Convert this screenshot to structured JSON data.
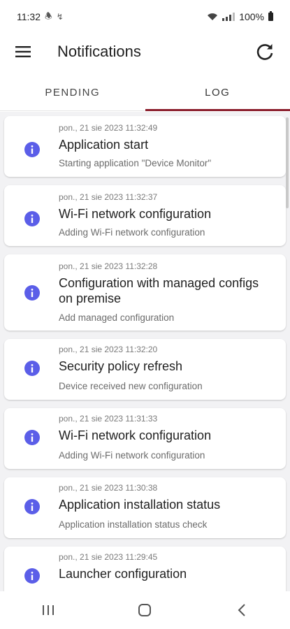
{
  "status_bar": {
    "time": "11:32",
    "battery": "100%",
    "icons": [
      "notification-icon",
      "app-icon",
      "wifi-icon",
      "signal-icon",
      "battery-icon"
    ]
  },
  "appbar": {
    "title": "Notifications",
    "menu_icon": "hamburger-menu-icon",
    "refresh_icon": "refresh-icon"
  },
  "tabs": [
    {
      "label": "PENDING",
      "selected": false
    },
    {
      "label": "LOG",
      "selected": true
    }
  ],
  "accent_color": "#8b1d2c",
  "info_icon_color": "#5b5ee8",
  "log_entries": [
    {
      "time": "pon., 21 sie 2023 11:32:49",
      "title": "Application start",
      "description": "Starting application \"Device Monitor\""
    },
    {
      "time": "pon., 21 sie 2023 11:32:37",
      "title": "Wi-Fi network configuration",
      "description": "Adding Wi-Fi network configuration"
    },
    {
      "time": "pon., 21 sie 2023 11:32:28",
      "title": "Configuration with managed configs on premise",
      "description": "Add managed configuration"
    },
    {
      "time": "pon., 21 sie 2023 11:32:20",
      "title": "Security policy refresh",
      "description": "Device received new configuration"
    },
    {
      "time": "pon., 21 sie 2023 11:31:33",
      "title": "Wi-Fi network configuration",
      "description": "Adding Wi-Fi network configuration"
    },
    {
      "time": "pon., 21 sie 2023 11:30:38",
      "title": "Application installation status",
      "description": "Application installation status check"
    },
    {
      "time": "pon., 21 sie 2023 11:29:45",
      "title": "Launcher configuration",
      "description": ""
    }
  ],
  "nav_bar": {
    "icons": [
      "recents-icon",
      "home-icon",
      "back-icon"
    ]
  }
}
